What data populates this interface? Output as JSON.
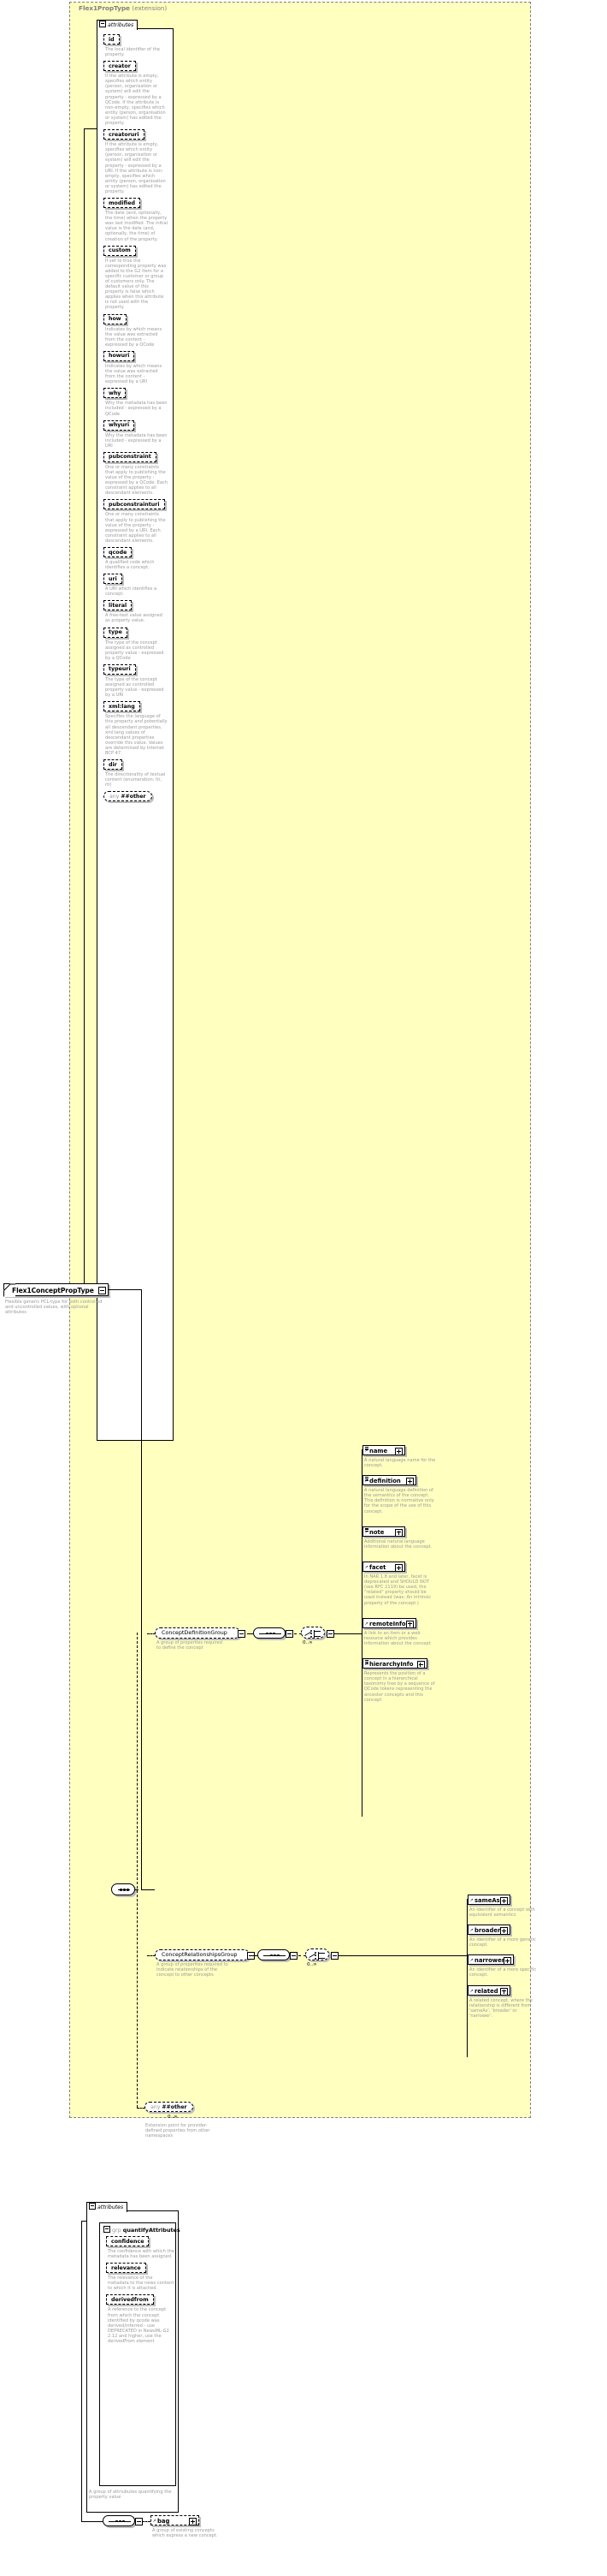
{
  "diagram": {
    "type": "xsd-schema-documentation",
    "root_type": {
      "name": "Flex1ConceptPropType",
      "description": "Flexible generic PCL-type for both controlled and uncontrolled values, with optional attributes"
    },
    "extension_panel": {
      "title": "Flex1PropType",
      "title_suffix": "(extension)"
    },
    "attributes_label": "attributes",
    "group_label": "grp",
    "quantify_group_name": "quantifyAttributes",
    "quantify_group_description": "A group of attriubutes quantifying the property value",
    "attributes": [
      {
        "name": "id",
        "description": "The local identifier of the property."
      },
      {
        "name": "creator",
        "description": "If the attribute is empty, specifies which entity (person, organisation or system) will edit the property - expressed by a QCode. If the attribute is non-empty, specifies which entity (person, organisation or system) has edited the property."
      },
      {
        "name": "creatoruri",
        "description": "If the attribute is empty, specifies which entity (person, organisation or system) will edit the property - expressed by a URI. If the attribute is non-empty, specifies which entity (person, organisation or system) has edited the property."
      },
      {
        "name": "modified",
        "description": "The date (and, optionally, the time) when the property was last modified. The initial value is the date (and, optionally, the time) of creation of the property."
      },
      {
        "name": "custom",
        "description": "If set to true the corresponding property was added to the G2 Item for a specific customer or group of customers only. The default value of this property is false which applies when this attribute is not used with the property."
      },
      {
        "name": "how",
        "description": "Indicates by which means the value was extracted from the content - expressed by a QCode"
      },
      {
        "name": "howuri",
        "description": "Indicates by which means the value was extracted from the content - expressed by a URI"
      },
      {
        "name": "why",
        "description": "Why the metadata has been included - expressed by a QCode"
      },
      {
        "name": "whyuri",
        "description": "Why the metadata has been included - expressed by a URI"
      },
      {
        "name": "pubconstraint",
        "description": "One or many constraints that apply to publishing the value of the property - expressed by a QCode. Each constraint applies to all descendant elements."
      },
      {
        "name": "pubconstrainturi",
        "description": "One or many constraints that apply to publishing the value of the property - expressed by a URI. Each constraint applies to all descendant elements."
      },
      {
        "name": "qcode",
        "description": "A qualified code which identifies a concept."
      },
      {
        "name": "uri",
        "description": "A URI which identifies a concept."
      },
      {
        "name": "literal",
        "description": "A free-text value assigned as property value."
      },
      {
        "name": "type",
        "description": "The type of the concept assigned as controlled property value - expressed by a QCode"
      },
      {
        "name": "typeuri",
        "description": "The type of the concept assigned as controlled property value - expressed by a URI"
      },
      {
        "name": "xml:lang",
        "description": "Specifies the language of this property and potentially all descendant properties. xml:lang values of descendant properties override this value. Values are determined by Internet BCP 47."
      },
      {
        "name": "dir",
        "description": "The directionality of textual content (enumeration: ltr, rtl)"
      }
    ],
    "any_attribute": {
      "any": "any",
      "ns": "##other"
    },
    "groups": [
      {
        "name": "ConceptDefinitionGroup",
        "description": "A group of properites required to define the concept",
        "cardinality": "0..∞",
        "elements": [
          {
            "name": "name",
            "description": "A natural language name for the concept."
          },
          {
            "name": "definition",
            "description": "A natural language definition of the semantics of the concept. This definition is normative only for the scope of the use of this concept."
          },
          {
            "name": "note",
            "description": "Additional natural language information about the concept."
          },
          {
            "name": "facet",
            "description": "In NAR 1.8 and later, facet is deprecated and SHOULD NOT (see RFC 2119) be used, the \"related\" property should be used instead (was: An intrinsic property of the concept.)"
          },
          {
            "name": "remoteInfo",
            "description": "A link to an item or a web resource which provides information about the concept"
          },
          {
            "name": "hierarchyInfo",
            "description": "Represents the position of a concept in a hierarchical taxonomy tree by a sequence of QCode tokens representing the ancestor concepts and this concept"
          }
        ]
      },
      {
        "name": "ConceptRelationshipsGroup",
        "description": "A group of properites required to indicate relationships of the concept to other concepts",
        "cardinality": "0..∞",
        "elements": [
          {
            "name": "sameAs",
            "description": "An identifier of a concept with equivalent semantics"
          },
          {
            "name": "broader",
            "description": "An identifier of a more generic concept."
          },
          {
            "name": "narrower",
            "description": "An identifier of a more specific concept."
          },
          {
            "name": "related",
            "description": "A related concept, where the relationship is different from 'sameAs', 'broader' or 'narrower'."
          }
        ]
      }
    ],
    "any_element": {
      "any": "any",
      "ns": "##other",
      "cardinality": "0..∞",
      "description": "Extension point for provider-defined properties from other namespaces"
    },
    "quantify_attributes": [
      {
        "name": "confidence",
        "description": "The confidence with which the metadata has been assigned."
      },
      {
        "name": "relevance",
        "description": "The relevance of the metadata to the news content to which it is attached."
      },
      {
        "name": "derivedfrom",
        "description": "A reference to the concept from which the concept identified by qcode was derived/inferred - use DEPRECATED in NewsML-G2 2.12 and higher, use the derivedFrom element"
      }
    ],
    "bag_element": {
      "name": "bag",
      "description": "A group of existing concepts which express a new concept."
    },
    "colors": {
      "panel_background": "#ffffc0",
      "panel_border": "#808080",
      "description_text": "#9a9a9a",
      "box_shadow": "#bdbdbd",
      "box_background": "#ffffff",
      "line": "#000000"
    }
  }
}
